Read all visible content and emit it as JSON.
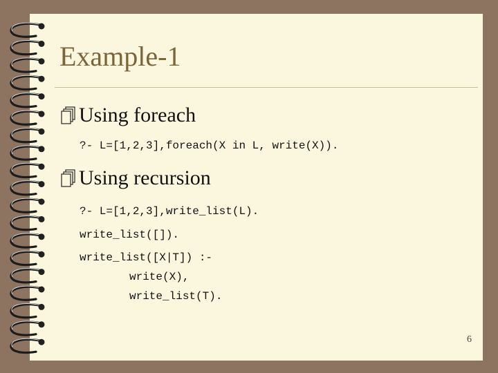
{
  "slide": {
    "title": "Example-1",
    "bullets": [
      {
        "label": "Using foreach",
        "code": [
          "?- L=[1,2,3],foreach(X in L, write(X))."
        ]
      },
      {
        "label": "Using recursion",
        "code": [
          "?- L=[1,2,3],write_list(L).",
          "write_list([]).",
          "write_list([X|T]) :-",
          "write(X),",
          "write_list(T)."
        ]
      }
    ],
    "page_number": "6"
  },
  "icons": {
    "bullet": "stacked-pages-icon",
    "binding": "spiral-binding"
  },
  "colors": {
    "background": "#8c7460",
    "paper": "#fbf7df",
    "title": "#7b6538",
    "rule": "#c8b89a"
  }
}
